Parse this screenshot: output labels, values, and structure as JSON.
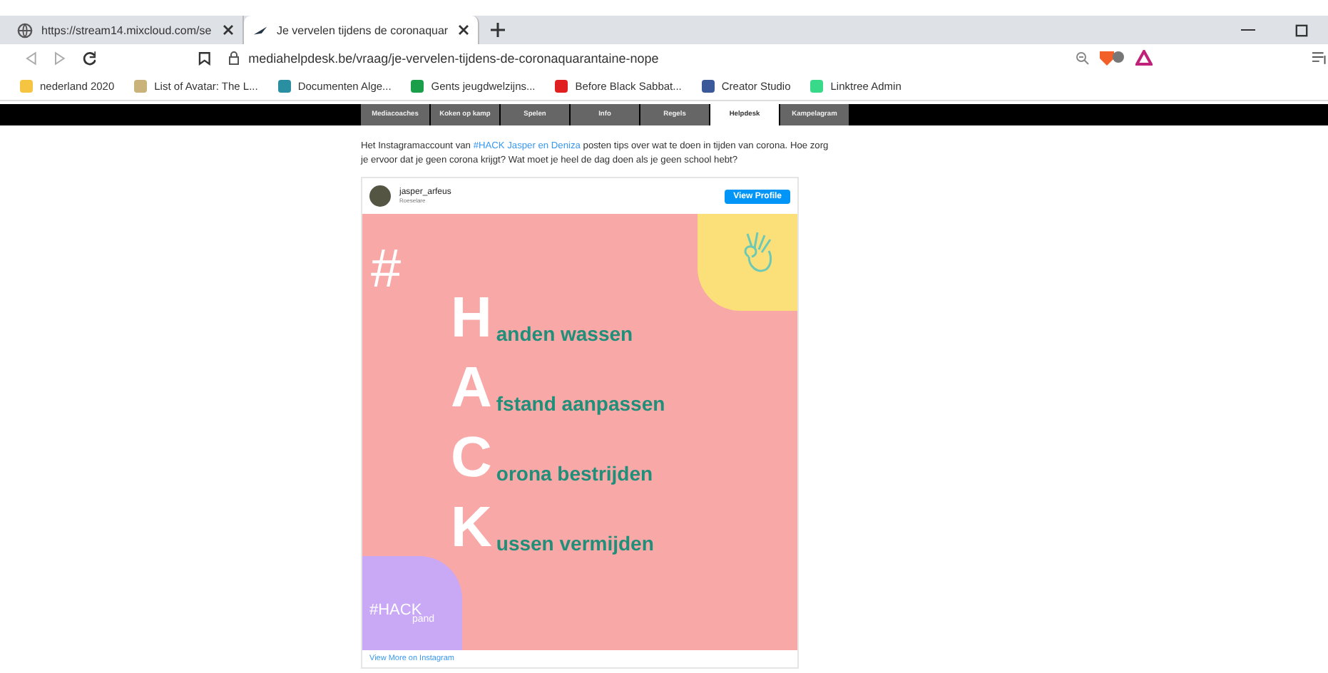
{
  "browser": {
    "tabs": [
      {
        "title": "https://stream14.mixcloud.com/se",
        "selected": false
      },
      {
        "title": "Je vervelen tijdens de coronaquar",
        "selected": true
      }
    ],
    "url": "mediahelpdesk.be/vraag/je-vervelen-tijdens-de-coronaquarantaine-nope",
    "bookmarks": [
      {
        "label": "nederland 2020",
        "color": "#f5c542"
      },
      {
        "label": "List of Avatar: The L...",
        "color": "#c9b37a"
      },
      {
        "label": "Documenten Alge...",
        "color": "#2a8fa0"
      },
      {
        "label": "Gents jeugdwelzijns...",
        "color": "#1a9e4a"
      },
      {
        "label": "Before Black Sabbat...",
        "color": "#e02020"
      },
      {
        "label": "Creator Studio",
        "color": "#3b5998"
      },
      {
        "label": "Linktree Admin",
        "color": "#39d98a"
      }
    ]
  },
  "nav": [
    {
      "label": "Mediacoaches",
      "selected": false
    },
    {
      "label": "Koken op kamp",
      "selected": false
    },
    {
      "label": "Spelen",
      "selected": false
    },
    {
      "label": "Info",
      "selected": false
    },
    {
      "label": "Regels",
      "selected": false
    },
    {
      "label": "Helpdesk",
      "selected": true
    },
    {
      "label": "Kampelagram",
      "selected": false
    }
  ],
  "intro": [
    {
      "kind": "text",
      "text": "Het Instagramaccount van"
    },
    {
      "kind": "link",
      "text": "#HACK Jasper en Deniza"
    },
    {
      "kind": "text",
      "text": "posten tips over wat te doen in tijden van corona. Hoe zorg je ervoor dat je geen corona krijgt? Wat moet je heel de dag doen als je geen school hebt?"
    }
  ],
  "post": {
    "username": "jasper_arfeus",
    "subtitle": "Roeselare",
    "button": "View Profile",
    "hash": "#",
    "lines": [
      {
        "letter": "H",
        "rest": "anden wassen"
      },
      {
        "letter": "A",
        "rest": "fstand aanpassen"
      },
      {
        "letter": "C",
        "rest": "orona bestrijden"
      },
      {
        "letter": "K",
        "rest": "ussen vermijden"
      }
    ],
    "logo": "#HACK",
    "logo_sub": "pand",
    "more": "View More on Instagram"
  }
}
